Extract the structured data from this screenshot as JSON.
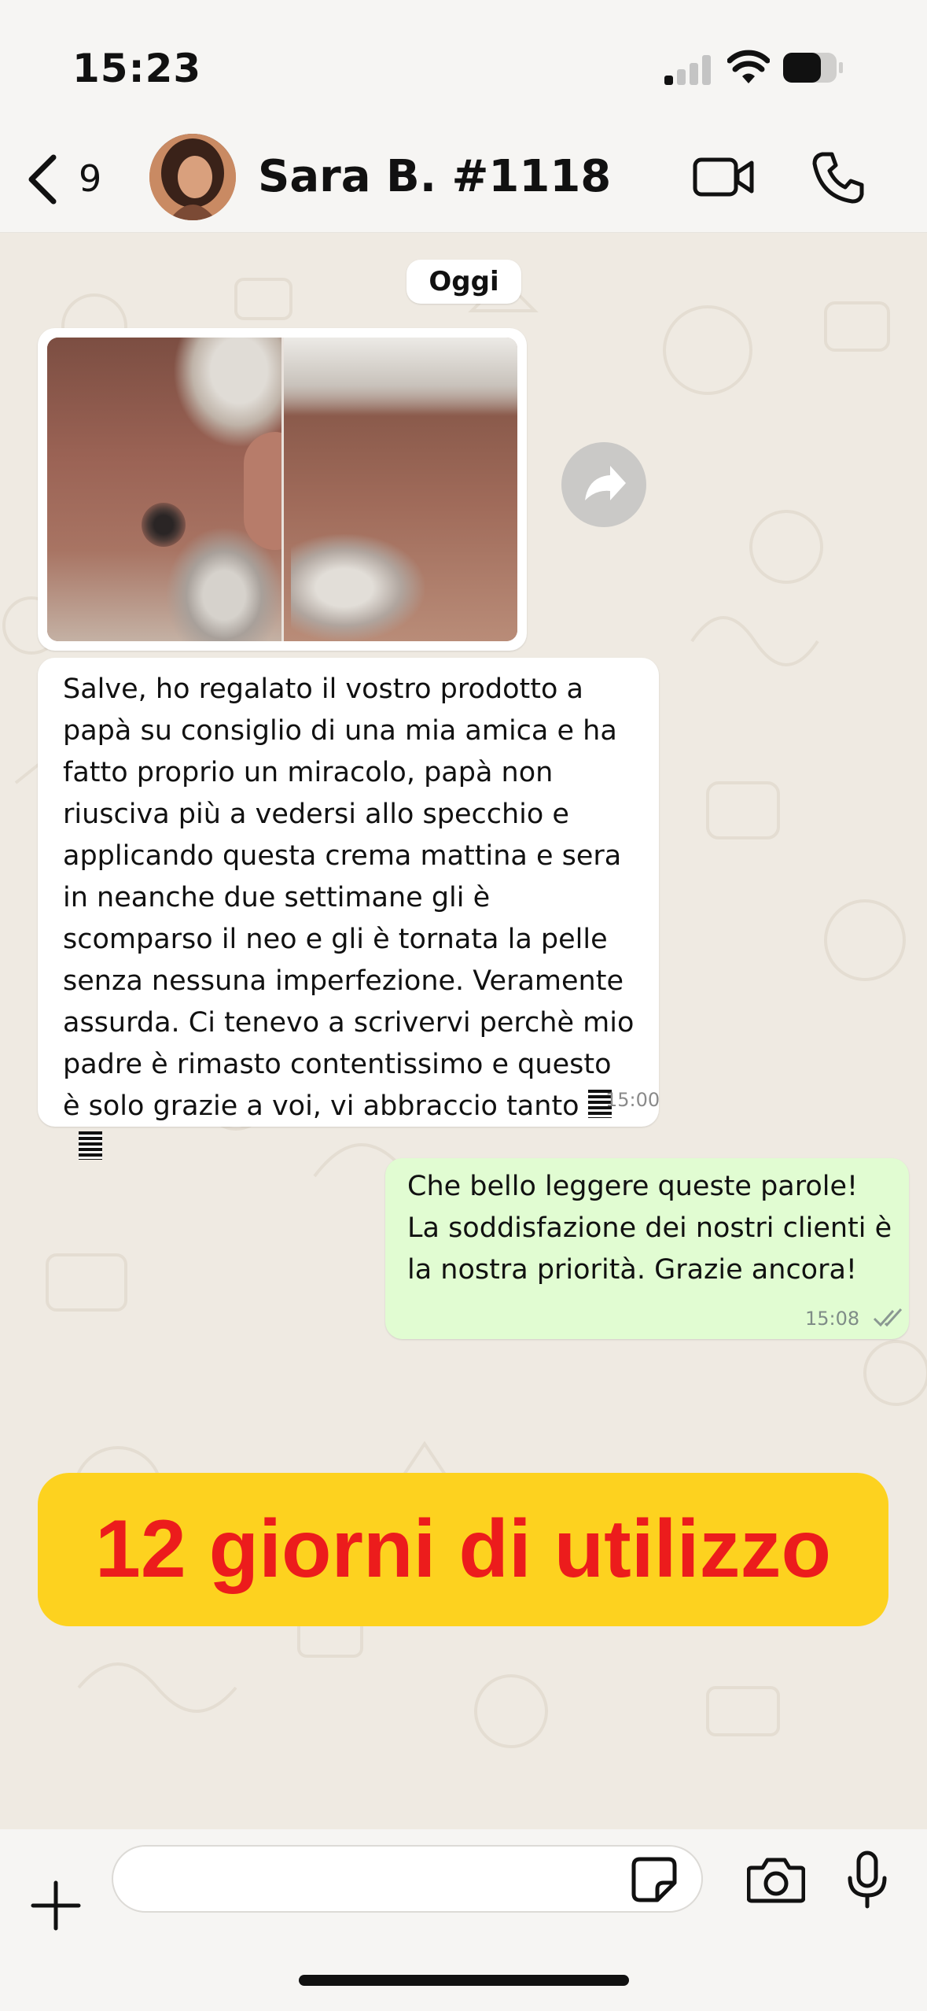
{
  "status_bar": {
    "time": "15:23"
  },
  "header": {
    "back_count": "9",
    "contact_name": "Sara B. #1118"
  },
  "chat": {
    "date_label": "Oggi",
    "incoming_message": {
      "text": "Salve, ho regalato il vostro prodotto a papà su consiglio di una mia amica e ha fatto proprio un miracolo, papà non riusciva più a vedersi allo specchio e applicando questa crema mattina e sera in neanche due settimane gli è scomparso il neo e gli è tornata la pelle senza nessuna imperfezione. Veramente assurda. Ci tenevo a scrivervi perchè mio padre è rimasto contentissimo e questo è solo grazie a voi, vi abbraccio tanto",
      "time": "15:00"
    },
    "outgoing_message": {
      "text": "Che bello leggere queste parole! La soddisfazione dei nostri clienti è la nostra priorità. Grazie ancora!",
      "time": "15:08"
    }
  },
  "promo_banner": {
    "text": "12 giorni di utilizzo",
    "background": "#fdd21f",
    "text_color": "#ec1c1c"
  },
  "input_bar": {
    "placeholder": ""
  },
  "icons": {
    "back": "chevron-left-icon",
    "video": "video-camera-icon",
    "call": "phone-icon",
    "forward": "forward-arrow-icon",
    "plus": "plus-icon",
    "sticker": "sticker-icon",
    "camera": "camera-icon",
    "mic": "microphone-icon"
  },
  "colors": {
    "outgoing_bubble": "#e1fcd2",
    "incoming_bubble": "#ffffff",
    "wallpaper": "#efeae2"
  }
}
